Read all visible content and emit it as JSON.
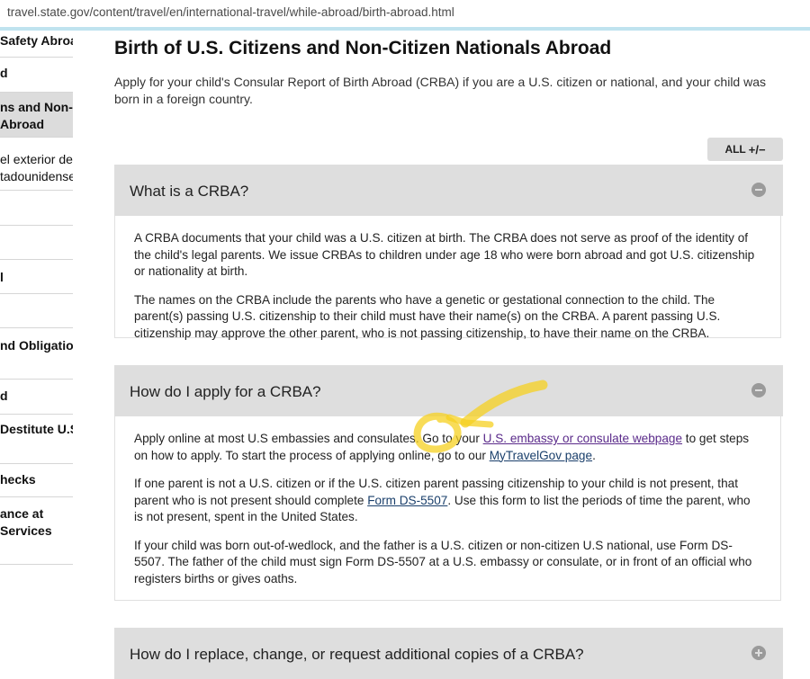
{
  "browser": {
    "url": "travel.state.gov/content/travel/en/international-travel/while-abroad/birth-abroad.html"
  },
  "sidebar": {
    "items": [
      {
        "lines": [
          "Safety Abroad"
        ],
        "bold": true,
        "active": false
      },
      {
        "lines": [
          "d"
        ],
        "bold": true,
        "active": false
      },
      {
        "lines": [
          "ns and Non-",
          "Abroad"
        ],
        "bold": true,
        "active": true
      },
      {
        "lines": [
          "el exterior de",
          "tadounidenses"
        ],
        "bold": false,
        "active": false
      },
      {
        "lines": [
          ""
        ],
        "bold": false,
        "active": false
      },
      {
        "lines": [
          ""
        ],
        "bold": false,
        "active": false
      },
      {
        "lines": [
          "l"
        ],
        "bold": true,
        "active": false
      },
      {
        "lines": [
          ""
        ],
        "bold": false,
        "active": false
      },
      {
        "lines": [
          "nd Obligations"
        ],
        "bold": true,
        "active": false
      },
      {
        "lines": [
          "d"
        ],
        "bold": true,
        "active": false
      },
      {
        "lines": [
          "Destitute U.S."
        ],
        "bold": true,
        "active": false
      },
      {
        "lines": [
          "hecks"
        ],
        "bold": true,
        "active": false
      },
      {
        "lines": [
          "ance at",
          "Services"
        ],
        "bold": true,
        "active": false
      }
    ]
  },
  "main": {
    "title": "Birth of U.S. Citizens and Non-Citizen Nationals Abroad",
    "intro": "Apply for your child's Consular Report of Birth Abroad (CRBA) if you are a U.S. citizen or national, and your child was born in a foreign country.",
    "all_toggle": {
      "label": "ALL",
      "icon": "+/−"
    }
  },
  "accordions": [
    {
      "title": "What is a CRBA?",
      "toggle_icon": "minus-circle",
      "paragraphs": [
        "A CRBA documents that your child was a U.S. citizen at birth. The CRBA does not serve as proof of the identity of the child's legal parents. We issue CRBAs to children under age 18 who were born abroad and got U.S. citizenship or nationality at birth.",
        "The names on the CRBA include the parents who have a genetic or gestational connection to the child. The parent(s) passing U.S. citizenship to their child must have their name(s) on the CRBA. A parent passing U.S. citizenship may approve the other parent, who is not passing citizenship, to have their name on the CRBA."
      ]
    },
    {
      "title": "How do I apply for a CRBA?",
      "toggle_icon": "minus-circle",
      "p1": {
        "t1": "Apply online at most U.S embassies and consulates. Go to your ",
        "link1": "U.S. embassy or consulate webpage",
        "t2": " to get steps on how to apply. To start the process of applying online, go to our ",
        "link2": "MyTravelGov page",
        "t3": "."
      },
      "p2": {
        "t1": "If one parent is not a U.S. citizen or if the U.S. citizen parent passing citizenship to your child is not present, that parent who is not present should complete ",
        "link": "Form DS-5507",
        "t2": ". Use this form to list the periods of time the parent, who is not present, spent in the United States."
      },
      "p3": "If your child was born out-of-wedlock, and the father is a U.S. citizen or non-citizen U.S national, use Form DS-5507. The father of the child must sign Form DS-5507 at a U.S. embassy or consulate, or in front of an official who registers births or gives oaths."
    },
    {
      "title": "How do I replace, change, or request additional copies of a CRBA?",
      "toggle_icon": "plus-circle"
    }
  ],
  "colors": {
    "accordion_header": "#dedede",
    "link": "#1a3f6b",
    "visited_link": "#5a2a8a",
    "annotation": "#f5d020"
  }
}
